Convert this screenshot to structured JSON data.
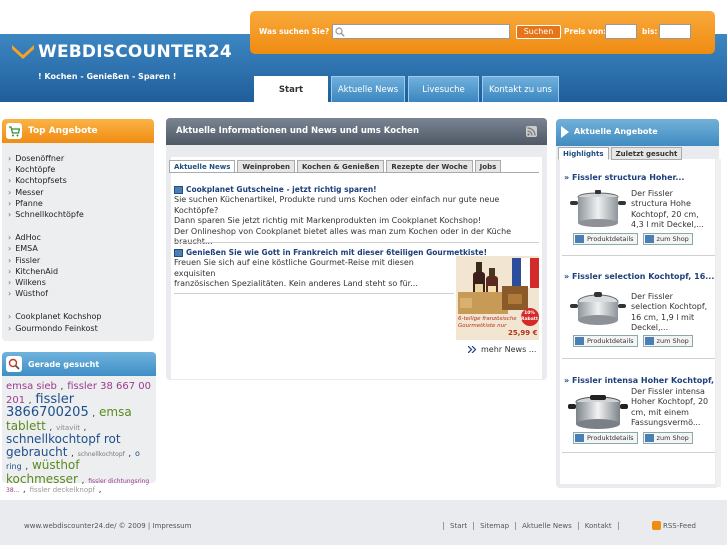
{
  "header": {
    "logo_text": "WEBDISCOUNTER24",
    "tagline": "! Kochen - Genießen - Sparen !"
  },
  "search": {
    "label": "Was suchen Sie?",
    "button_label": "Suchen",
    "price_from_label": "Preis von:",
    "price_to_label": "bis:"
  },
  "nav": {
    "tabs": [
      {
        "label": "Start"
      },
      {
        "label": "Aktuelle News"
      },
      {
        "label": "Livesuche"
      },
      {
        "label": "Kontakt zu uns"
      }
    ]
  },
  "top_offers": {
    "title": "Top Angebote",
    "group1": [
      "Dosenöffner",
      "Kochtöpfe",
      "Kochtopfsets",
      "Messer",
      "Pfanne",
      "Schnellkochtöpfe"
    ],
    "group2": [
      "AdHoc",
      "EMSA",
      "Fissler",
      "KitchenAid",
      "Wilkens",
      "Wüsthof"
    ],
    "group3": [
      "Cookplanet Kochshop",
      "Gourmondo Feinkost"
    ]
  },
  "recent_searches": {
    "title": "Gerade gesucht",
    "tags": [
      {
        "text": "emsa sieb",
        "color": "#9b3b8e",
        "size": 10
      },
      {
        "text": ", ",
        "color": "#333",
        "size": 9
      },
      {
        "text": "fissler 38 667 00 201",
        "color": "#9b3b8e",
        "size": 10
      },
      {
        "text": ", ",
        "color": "#333",
        "size": 9
      },
      {
        "text": "fissler 3866700205",
        "color": "#1f4f8a",
        "size": 13
      },
      {
        "text": ", ",
        "color": "#333",
        "size": 9
      },
      {
        "text": "emsa tablett",
        "color": "#5a8a1f",
        "size": 12
      },
      {
        "text": ", ",
        "color": "#333",
        "size": 9
      },
      {
        "text": "vitaviit",
        "color": "#888",
        "size": 7
      },
      {
        "text": ", ",
        "color": "#333",
        "size": 9
      },
      {
        "text": "schnellkochtopf rot",
        "color": "#1f4f8a",
        "size": 12
      },
      {
        "text": "gebraucht",
        "color": "#1f4f8a",
        "size": 12
      },
      {
        "text": ", ",
        "color": "#333",
        "size": 9
      },
      {
        "text": "schnellkochtopf",
        "color": "#777",
        "size": 6
      },
      {
        "text": ", ",
        "color": "#333",
        "size": 9
      },
      {
        "text": "o ring",
        "color": "#1f4f8a",
        "size": 8
      },
      {
        "text": ", ",
        "color": "#333",
        "size": 9
      },
      {
        "text": "wüsthof kochmesser",
        "color": "#5a8a1f",
        "size": 12
      },
      {
        "text": ", ",
        "color": "#333",
        "size": 9
      },
      {
        "text": "fissler dichtungsring 38...",
        "color": "#9b3b8e",
        "size": 6
      },
      {
        "text": ", ",
        "color": "#333",
        "size": 9
      },
      {
        "text": "fissler deckelknopf",
        "color": "#999",
        "size": 7
      },
      {
        "text": ", ",
        "color": "#333",
        "size": 9
      }
    ]
  },
  "news": {
    "title": "Aktuelle Informationen und News und ums Kochen",
    "tabs": [
      {
        "label": "Aktuelle News"
      },
      {
        "label": "Weinproben"
      },
      {
        "label": "Kochen & Genießen"
      },
      {
        "label": "Rezepte der Woche"
      },
      {
        "label": "Jobs"
      }
    ],
    "items": [
      {
        "title": "Cookplanet Gutscheine - jetzt richtig sparen!",
        "lines": [
          "Sie suchen Küchenartikel, Produkte rund ums Kochen oder einfach nur gute neue Kochtöpfe?",
          "Dann sparen Sie jetzt richtig mit Markenprodukten im Cookplanet Kochshop!",
          "Der Onlineshop von Cookplanet bietet alles was man zum Kochen oder in der Küche braucht..."
        ]
      },
      {
        "title": "Genießen Sie wie Gott in Frankreich mit dieser 6teiligen Gourmetkiste!",
        "lines": [
          "Freuen Sie sich auf eine köstliche Gourmet-Reise mit diesen exquisiten",
          "französischen Spezialitäten. Kein anderes Land steht so für..."
        ]
      }
    ],
    "image": {
      "caption_line1": "6-teilige französische",
      "caption_line2": "Gourmetkiste nur",
      "price": "25,99 €",
      "badge": "10% Rabatt"
    },
    "more_label": "mehr News ..."
  },
  "offers": {
    "title": "Aktuelle Angebote",
    "tabs": [
      {
        "label": "Highlights"
      },
      {
        "label": "Zuletzt gesucht"
      }
    ],
    "details_label": "Produktdetails",
    "shop_label": "zum Shop",
    "items": [
      {
        "title": "» Fissler structura Hoher...",
        "desc": "Der Fissler structura Hohe Kochtopf, 20 cm, 4,3 l mit Deckel,..."
      },
      {
        "title": "» Fissler selection Kochtopf, 16...",
        "desc": "Der Fissler selection Kochtopf, 16 cm, 1,9 l mit Deckel,..."
      },
      {
        "title": "» Fissler intensa Hoher Kochtopf,...",
        "desc": "Der Fissler intensa Hoher Kochtopf, 20 cm, mit einem Fassungsvermö..."
      }
    ]
  },
  "footer": {
    "copyright": "www.webdiscounter24.de/ © 2009 |",
    "impressum": "Impressum",
    "links": [
      {
        "label": "Start"
      },
      {
        "label": "Sitemap"
      },
      {
        "label": "Aktuelle News"
      },
      {
        "label": "Kontakt"
      }
    ],
    "rss_label": "RSS-Feed"
  },
  "colors": {
    "header_blue": "#2a6fad",
    "accent_orange": "#f08c12",
    "link_blue": "#1d3f7a"
  }
}
